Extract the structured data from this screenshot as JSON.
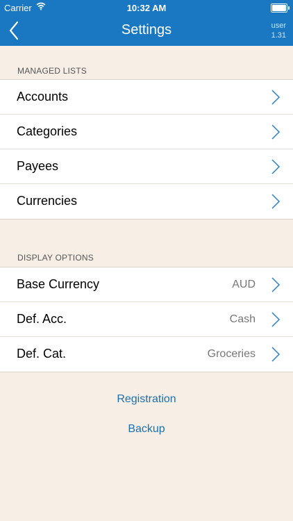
{
  "status_bar": {
    "carrier": "Carrier",
    "time": "10:32 AM"
  },
  "nav": {
    "title": "Settings",
    "user_label": "user",
    "user_version": "1.31"
  },
  "managed_lists": {
    "header": "MANAGED LISTS",
    "items": [
      {
        "label": "Accounts"
      },
      {
        "label": "Categories"
      },
      {
        "label": "Payees"
      },
      {
        "label": "Currencies"
      }
    ]
  },
  "display_options": {
    "header": "DISPLAY OPTIONS",
    "items": [
      {
        "label": "Base Currency",
        "value": "AUD"
      },
      {
        "label": "Def. Acc.",
        "value": "Cash"
      },
      {
        "label": "Def. Cat.",
        "value": "Groceries"
      }
    ]
  },
  "links": {
    "registration": "Registration",
    "backup": "Backup"
  },
  "colors": {
    "accent": "#1a78c2",
    "background": "#f7efe6",
    "link": "#1a6fb2",
    "chevron": "#2b7fc4"
  },
  "icons": {
    "back": "chevron-left-icon",
    "row": "chevron-right-icon",
    "wifi": "wifi-icon",
    "battery": "battery-icon"
  }
}
